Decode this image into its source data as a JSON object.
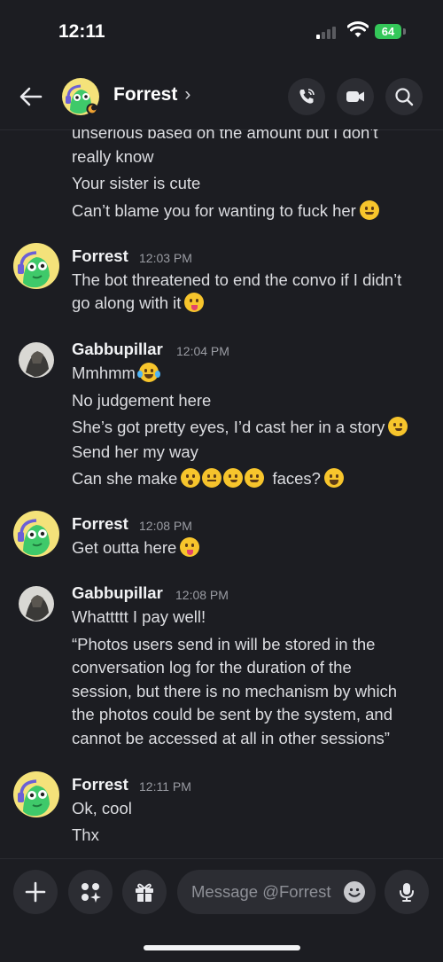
{
  "status_bar": {
    "time": "12:11",
    "battery": "64"
  },
  "header": {
    "name": "Forrest",
    "chevron": "›"
  },
  "messages": {
    "partial_lines": [
      "unserious based on the amount but I don’t",
      "really know",
      "Your sister is cute",
      "Can’t blame you for wanting to fuck her"
    ],
    "groups": [
      {
        "author": "Forrest",
        "time": "12:03 PM",
        "lines": [
          "The bot threatened to end the convo if I didn’t",
          "go along with it"
        ]
      },
      {
        "author": "Gabbupillar",
        "time": "12:04 PM",
        "lines": [
          "Mmhmm",
          "No judgement here",
          "She’s got pretty eyes, I’d cast her in a story",
          "Send her my way",
          "Can she make",
          "faces?"
        ]
      },
      {
        "author": "Forrest",
        "time": "12:08 PM",
        "lines": [
          "Get outta here"
        ]
      },
      {
        "author": "Gabbupillar",
        "time": "12:08 PM",
        "lines": [
          "Whattttt I pay well!",
          "“Photos users send in will be stored in the",
          "conversation log for the duration of the",
          "session, but there is no mechanism by which",
          "the photos could be sent by the system, and",
          "cannot be accessed at all in other sessions”"
        ]
      },
      {
        "author": "Forrest",
        "time": "12:11 PM",
        "lines": [
          "Ok, cool",
          "Thx"
        ]
      }
    ]
  },
  "composer": {
    "placeholder": "Message @Forrest"
  },
  "colors": {
    "background": "#1c1d22",
    "button": "#2c2d33",
    "forrest_avatar_bg": "#f4e27a",
    "forrest_avatar_fg": "#3fc96a"
  }
}
